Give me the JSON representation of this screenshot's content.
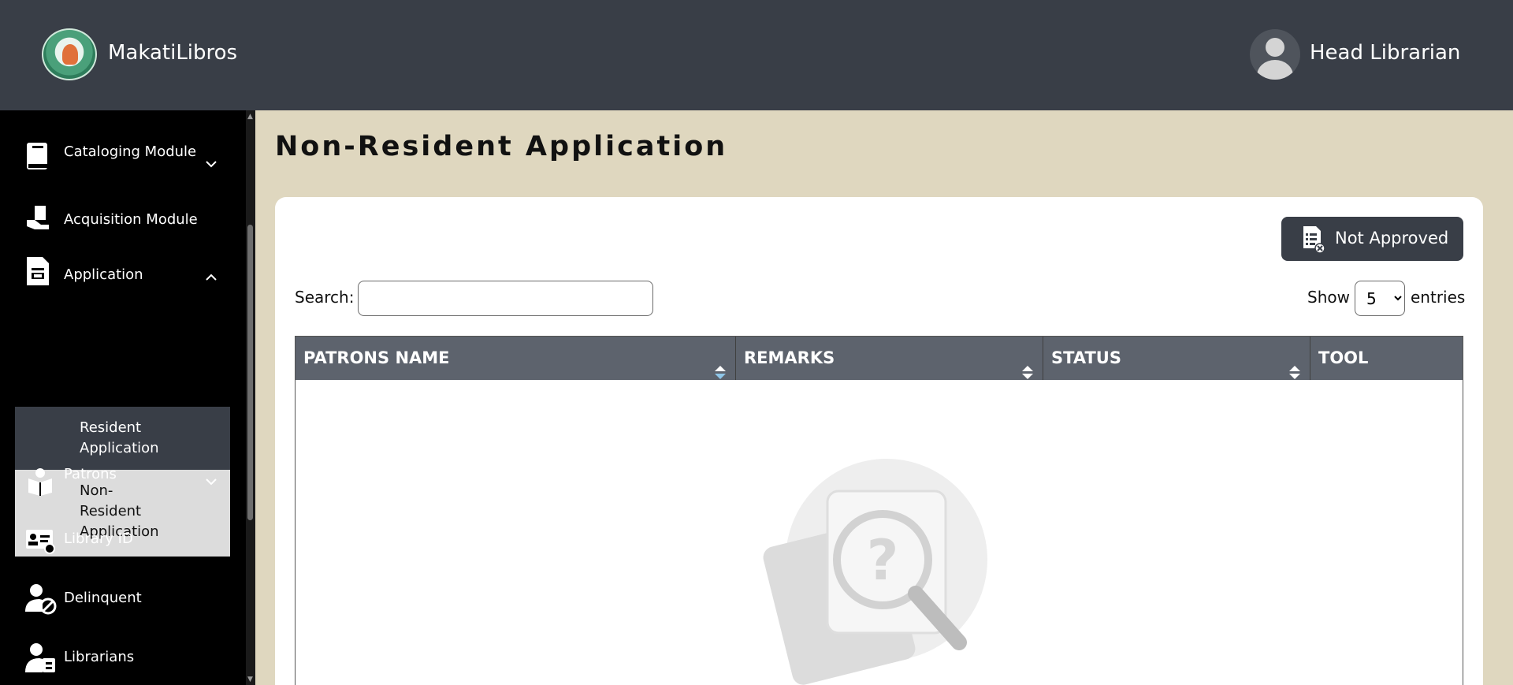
{
  "header": {
    "brand": "MakatiLibros",
    "user_role": "Head Librarian"
  },
  "sidebar": {
    "items": [
      {
        "label": "Cataloging Module",
        "icon": "book-icon",
        "expandable": true,
        "expanded": false
      },
      {
        "label": "Acquisition Module",
        "icon": "acquisition-icon",
        "expandable": false
      },
      {
        "label": "Application",
        "icon": "document-icon",
        "expandable": true,
        "expanded": true
      },
      {
        "label": "Patrons",
        "icon": "patrons-icon",
        "expandable": true,
        "expanded": false
      },
      {
        "label": "Library ID",
        "icon": "id-card-icon",
        "expandable": false
      },
      {
        "label": "Delinquent",
        "icon": "delinquent-icon",
        "expandable": false
      },
      {
        "label": "Librarians",
        "icon": "librarians-icon",
        "expandable": false
      }
    ],
    "application_sub": [
      {
        "label": "Resident Application",
        "active": false
      },
      {
        "label": "Non-Resident Application",
        "active": true
      }
    ]
  },
  "main": {
    "title": "Non-Resident Application",
    "not_approved_label": "Not Approved",
    "search_label": "Search:",
    "search_value": "",
    "show_label": "Show",
    "entries_value": "5",
    "entries_label": "entries",
    "columns": [
      "PATRONS NAME",
      "REMARKS",
      "STATUS",
      "TOOL"
    ]
  },
  "colors": {
    "topbar": "#393e47",
    "sidebar": "#000000",
    "background": "#dfd7bf",
    "table_header": "#5d636d"
  }
}
